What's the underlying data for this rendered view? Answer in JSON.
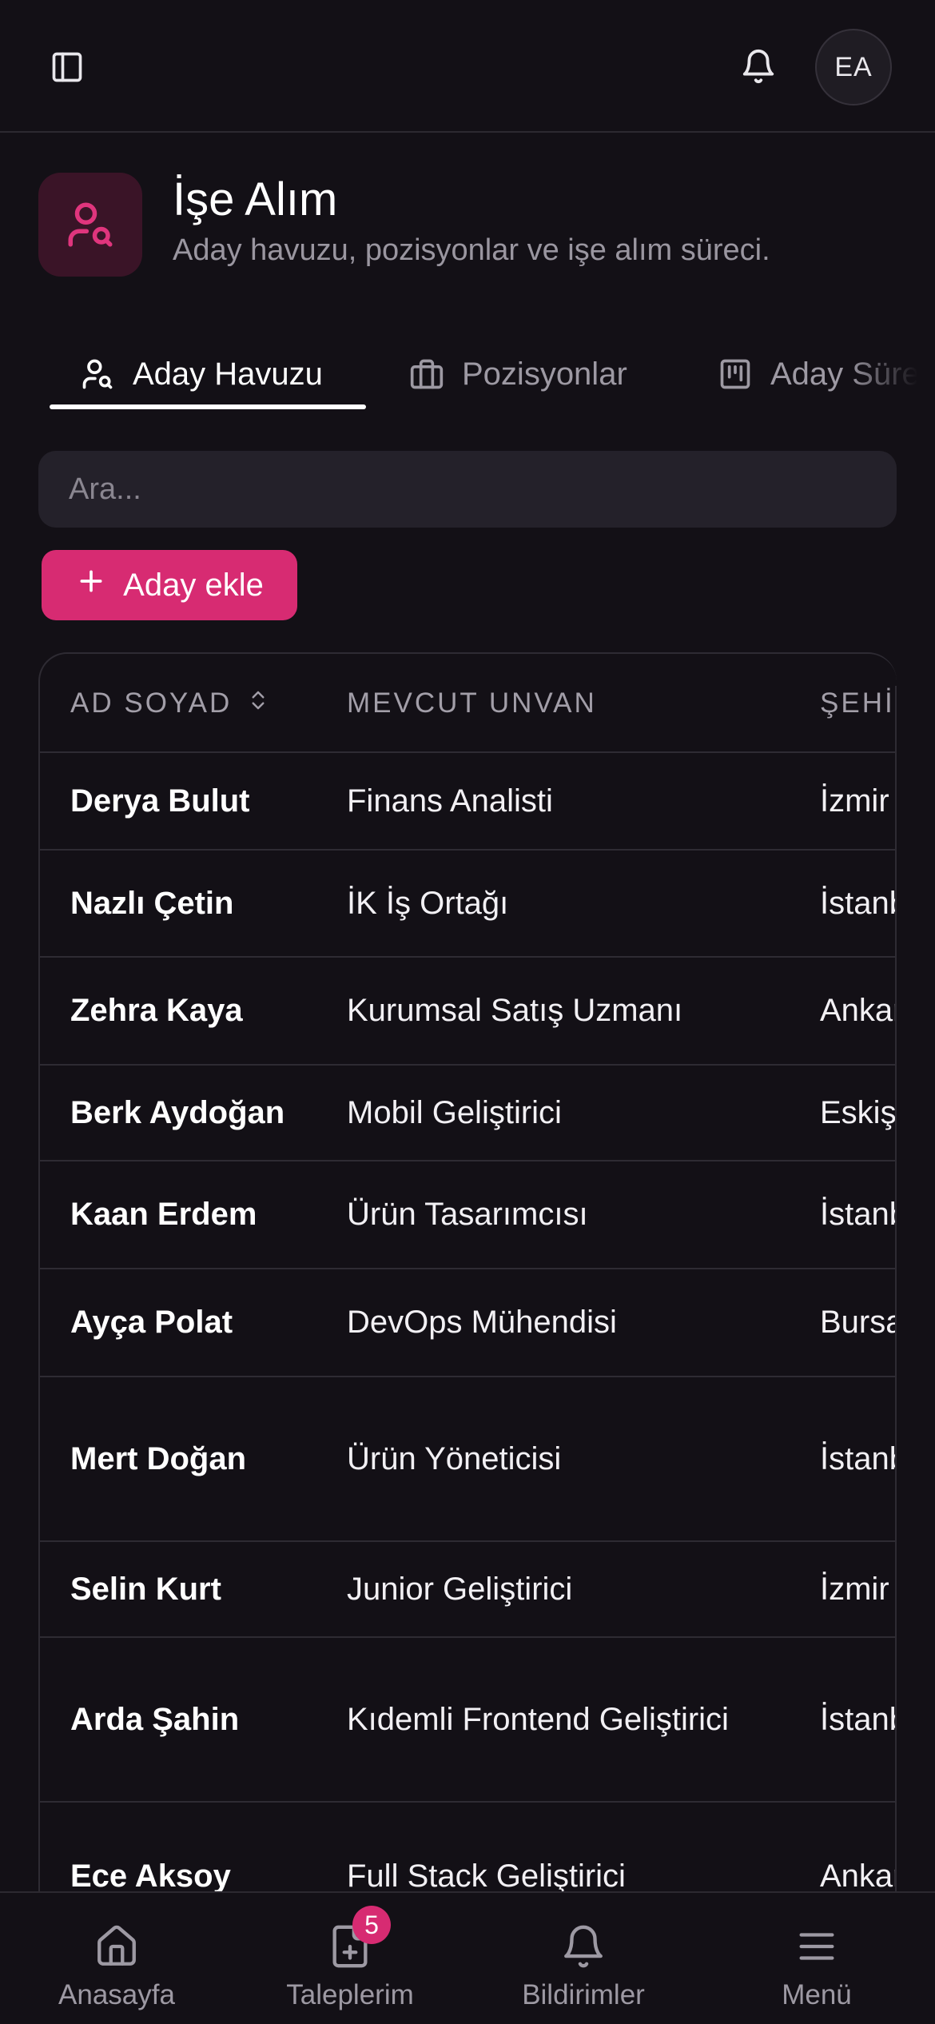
{
  "header": {
    "avatar_initials": "EA"
  },
  "page": {
    "title": "İşe Alım",
    "subtitle": "Aday havuzu, pozisyonlar ve işe alım süreci.",
    "accent_color": "#d72b72"
  },
  "tabs": [
    {
      "label": "Aday Havuzu",
      "icon": "user-search-icon",
      "active": true
    },
    {
      "label": "Pozisyonlar",
      "icon": "briefcase-icon",
      "active": false
    },
    {
      "label": "Aday Süreci",
      "icon": "kanban-icon",
      "active": false
    }
  ],
  "search": {
    "placeholder": "Ara..."
  },
  "actions": {
    "add_candidate_label": "Aday ekle"
  },
  "table": {
    "columns": [
      "AD SOYAD",
      "MEVCUT UNVAN",
      "ŞEHİR"
    ],
    "rows": [
      {
        "name": "Derya Bulut",
        "title": "Finans Analisti",
        "city": "İzmir"
      },
      {
        "name": "Nazlı Çetin",
        "title": "İK İş Ortağı",
        "city": "İstanbul"
      },
      {
        "name": "Zehra Kaya",
        "title": "Kurumsal Satış Uzmanı",
        "city": "Ankara"
      },
      {
        "name": "Berk Aydoğan",
        "title": "Mobil Geliştirici",
        "city": "Eskişehir"
      },
      {
        "name": "Kaan Erdem",
        "title": "Ürün Tasarımcısı",
        "city": "İstanbul"
      },
      {
        "name": "Ayça Polat",
        "title": "DevOps Mühendisi",
        "city": "Bursa"
      },
      {
        "name": "Mert Doğan",
        "title": "Ürün Yöneticisi",
        "city": "İstanbul"
      },
      {
        "name": "Selin Kurt",
        "title": "Junior Geliştirici",
        "city": "İzmir"
      },
      {
        "name": "Arda Şahin",
        "title": "Kıdemli Frontend Geliştirici",
        "city": "İstanbul"
      },
      {
        "name": "Ece Aksoy",
        "title": "Full Stack Geliştirici",
        "city": "Ankara"
      }
    ]
  },
  "bottom_nav": [
    {
      "label": "Anasayfa",
      "icon": "home-icon"
    },
    {
      "label": "Taleplerim",
      "icon": "file-plus-icon",
      "badge": "5"
    },
    {
      "label": "Bildirimler",
      "icon": "bell-icon"
    },
    {
      "label": "Menü",
      "icon": "menu-icon"
    }
  ]
}
